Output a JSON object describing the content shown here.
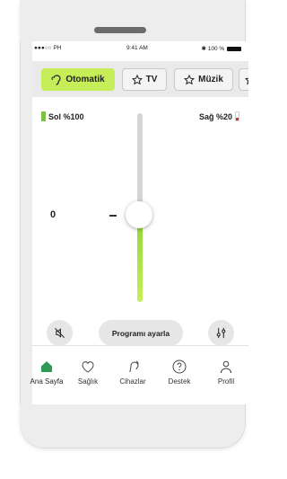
{
  "statusbar": {
    "carrier": "●●●○○ PH",
    "time": "9:41 AM",
    "battery": "100 %"
  },
  "programs": [
    {
      "label": "Otomatik",
      "icon": "ear-icon",
      "active": true
    },
    {
      "label": "TV",
      "icon": "star-icon",
      "active": false
    },
    {
      "label": "Müzik",
      "icon": "star-icon",
      "active": false
    }
  ],
  "left_device": {
    "label": "Sol %100",
    "battery_fraction": 1.0
  },
  "right_device": {
    "label": "Sağ %20",
    "battery_fraction": 0.2
  },
  "volume": {
    "value_label": "0",
    "level_fraction": 0.46
  },
  "controls": {
    "mute_icon": "speaker-mute-icon",
    "adjust_label": "Programı ayarla",
    "settings_icon": "sliders-icon"
  },
  "tabs": [
    {
      "label": "Ana Sayfa",
      "icon": "home-icon",
      "active": true
    },
    {
      "label": "Sağlık",
      "icon": "heart-icon",
      "active": false
    },
    {
      "label": "Cihazlar",
      "icon": "hearing-aid-icon",
      "active": false
    },
    {
      "label": "Destek",
      "icon": "help-icon",
      "active": false
    },
    {
      "label": "Profil",
      "icon": "person-icon",
      "active": false
    }
  ],
  "colors": {
    "accent": "#c6ee58",
    "accent_dark": "#7cc242",
    "low_battery": "#d9342b",
    "home_active": "#2e9a56"
  }
}
